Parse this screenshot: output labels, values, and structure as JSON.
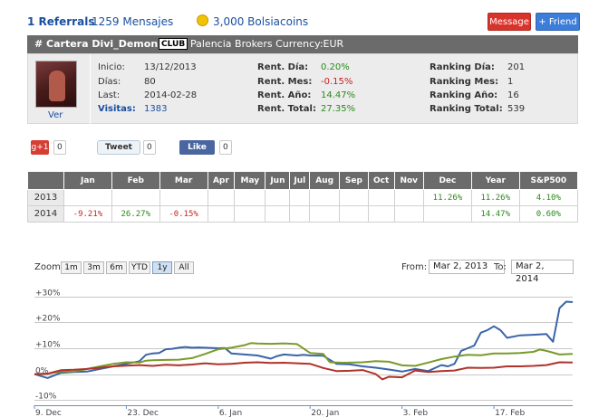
{
  "topbar": {
    "referrals": "1 Referrals",
    "mensajes": "1259 Mensajes",
    "bolsiacoins": "3,000 Bolsiacoins",
    "message_btn": "Message",
    "friend_btn": "+ Friend"
  },
  "header": {
    "title": "# Cartera Divi_Demon",
    "club_badge": "CLUB",
    "broker": "Palencia Brokers  Currency:EUR"
  },
  "profile": {
    "ver_link": "Ver",
    "stats_left": [
      {
        "label": "Inicio:",
        "value": "13/12/2013"
      },
      {
        "label": "Días:",
        "value": "80"
      },
      {
        "label": "Last:",
        "value": "2014-02-28"
      },
      {
        "label": "Visitas:",
        "value": "1383"
      }
    ],
    "stats_mid": [
      {
        "label": "Rent. Día:",
        "value": "0.20%"
      },
      {
        "label": "Rent. Mes:",
        "value": "-0.15%"
      },
      {
        "label": "Rent. Año:",
        "value": "14.47%"
      },
      {
        "label": "Rent. Total:",
        "value": "27.35%"
      }
    ],
    "stats_right": [
      {
        "label": "Ranking Día:",
        "value": "201"
      },
      {
        "label": "Ranking Mes:",
        "value": "1"
      },
      {
        "label": "Ranking Año:",
        "value": "16"
      },
      {
        "label": "Ranking Total:",
        "value": "539"
      }
    ]
  },
  "social": {
    "gplus_label": "g+1",
    "gplus_count": "0",
    "tweet_label": "Tweet",
    "tweet_count": "0",
    "like_label": "Like",
    "like_count": "0"
  },
  "table": {
    "headers": [
      "",
      "Jan",
      "Feb",
      "Mar",
      "Apr",
      "May",
      "Jun",
      "Jul",
      "Aug",
      "Sep",
      "Oct",
      "Nov",
      "Dec",
      "Year",
      "S&P500"
    ],
    "rows": [
      {
        "year": "2013",
        "cells": [
          "",
          "",
          "",
          "",
          "",
          "",
          "",
          "",
          "",
          "",
          "",
          "11.26%",
          "11.26%",
          "4.10%"
        ]
      },
      {
        "year": "2014",
        "cells": [
          "-9.21%",
          "26.27%",
          "-0.15%",
          "",
          "",
          "",
          "",
          "",
          "",
          "",
          "",
          "",
          "14.47%",
          "0.60%"
        ]
      }
    ]
  },
  "zoom": {
    "label": "Zoom",
    "buttons": [
      "1m",
      "3m",
      "6m",
      "YTD",
      "1y",
      "All"
    ],
    "selected": "1y",
    "from_label": "From:",
    "from_value": "Mar 2, 2013",
    "to_label": "To:",
    "to_value": "Mar 2, 2014"
  },
  "chart_data": {
    "type": "line",
    "y_ticks": [
      "+30%",
      "+20%",
      "+10%",
      "0%",
      "-10%"
    ],
    "y_tick_values": [
      30,
      20,
      10,
      0,
      -10
    ],
    "ylim": [
      -12,
      32
    ],
    "x_ticks": [
      "9. Dec",
      "23. Dec",
      "6. Jan",
      "20. Jan",
      "3. Feb",
      "17. Feb"
    ],
    "x_tick_days": [
      0,
      14,
      28,
      42,
      56,
      70
    ],
    "x_range_days": [
      0,
      82
    ],
    "series": [
      {
        "color": "#3a64a8",
        "points": [
          [
            0,
            0
          ],
          [
            2,
            -1.5
          ],
          [
            4,
            0.5
          ],
          [
            6,
            0.8
          ],
          [
            8,
            1
          ],
          [
            10,
            2
          ],
          [
            12,
            3
          ],
          [
            14,
            4
          ],
          [
            15,
            4.5
          ],
          [
            16,
            5
          ],
          [
            17,
            7.5
          ],
          [
            18,
            8
          ],
          [
            19,
            8.2
          ],
          [
            20,
            9.6
          ],
          [
            21,
            9.8
          ],
          [
            22,
            10.2
          ],
          [
            23,
            10.5
          ],
          [
            24,
            10.2
          ],
          [
            25,
            10.3
          ],
          [
            26,
            10.2
          ],
          [
            28,
            10
          ],
          [
            29,
            10.1
          ],
          [
            30,
            8
          ],
          [
            32,
            7.6
          ],
          [
            34,
            7.2
          ],
          [
            36,
            6
          ],
          [
            37,
            7
          ],
          [
            38,
            7.6
          ],
          [
            40,
            7.2
          ],
          [
            41,
            7.5
          ],
          [
            42,
            7.2
          ],
          [
            44,
            7.1
          ],
          [
            46,
            4
          ],
          [
            48,
            3.8
          ],
          [
            50,
            3
          ],
          [
            52,
            2.5
          ],
          [
            54,
            1.8
          ],
          [
            56,
            1
          ],
          [
            58,
            2
          ],
          [
            60,
            1.2
          ],
          [
            62,
            3.5
          ],
          [
            63,
            3
          ],
          [
            64,
            4
          ],
          [
            65,
            9
          ],
          [
            66,
            10
          ],
          [
            67,
            11
          ],
          [
            68,
            16
          ],
          [
            69,
            17
          ],
          [
            70,
            18.5
          ],
          [
            71,
            17
          ],
          [
            72,
            14
          ],
          [
            74,
            15
          ],
          [
            76,
            15.2
          ],
          [
            78,
            15.5
          ],
          [
            79,
            12.5
          ],
          [
            80,
            25.5
          ],
          [
            81,
            28
          ],
          [
            82,
            27.8
          ]
        ]
      },
      {
        "color": "#7a9a2a",
        "points": [
          [
            0,
            0
          ],
          [
            2,
            0.2
          ],
          [
            4,
            1
          ],
          [
            6,
            1
          ],
          [
            8,
            2
          ],
          [
            10,
            3
          ],
          [
            12,
            4
          ],
          [
            14,
            4.6
          ],
          [
            16,
            4.5
          ],
          [
            17,
            5.2
          ],
          [
            18,
            5.4
          ],
          [
            20,
            5.5
          ],
          [
            22,
            5.6
          ],
          [
            24,
            6.2
          ],
          [
            26,
            7.8
          ],
          [
            28,
            9.6
          ],
          [
            30,
            10.2
          ],
          [
            32,
            11.2
          ],
          [
            33,
            12
          ],
          [
            34,
            11.8
          ],
          [
            36,
            11.7
          ],
          [
            38,
            11.9
          ],
          [
            40,
            11.6
          ],
          [
            42,
            8.2
          ],
          [
            44,
            7.8
          ],
          [
            45,
            4.6
          ],
          [
            47,
            4.4
          ],
          [
            50,
            4.6
          ],
          [
            52,
            5
          ],
          [
            54,
            4.8
          ],
          [
            56,
            3.4
          ],
          [
            58,
            3.2
          ],
          [
            60,
            4.5
          ],
          [
            62,
            5.8
          ],
          [
            64,
            6.8
          ],
          [
            66,
            7.5
          ],
          [
            68,
            7.3
          ],
          [
            70,
            8
          ],
          [
            72,
            8
          ],
          [
            74,
            8.2
          ],
          [
            76,
            8.6
          ],
          [
            77,
            9.5
          ],
          [
            78,
            9
          ],
          [
            80,
            7.6
          ],
          [
            82,
            7.8
          ]
        ]
      },
      {
        "color": "#b0322a",
        "points": [
          [
            0,
            0
          ],
          [
            2,
            0.2
          ],
          [
            4,
            1.5
          ],
          [
            6,
            1.7
          ],
          [
            8,
            2
          ],
          [
            10,
            2.5
          ],
          [
            12,
            3
          ],
          [
            14,
            3.3
          ],
          [
            16,
            3.5
          ],
          [
            18,
            3.2
          ],
          [
            20,
            3.6
          ],
          [
            22,
            3.4
          ],
          [
            24,
            3.7
          ],
          [
            26,
            4.2
          ],
          [
            28,
            3.8
          ],
          [
            30,
            4
          ],
          [
            32,
            4.4
          ],
          [
            34,
            4.6
          ],
          [
            36,
            4.3
          ],
          [
            38,
            4.4
          ],
          [
            40,
            4.2
          ],
          [
            42,
            4
          ],
          [
            44,
            2.4
          ],
          [
            46,
            1.2
          ],
          [
            48,
            1.3
          ],
          [
            50,
            1.6
          ],
          [
            52,
            0
          ],
          [
            53,
            -2
          ],
          [
            54,
            -1
          ],
          [
            56,
            -1.2
          ],
          [
            58,
            1.4
          ],
          [
            60,
            0.8
          ],
          [
            62,
            1.2
          ],
          [
            64,
            1.4
          ],
          [
            66,
            2.5
          ],
          [
            68,
            2.4
          ],
          [
            70,
            2.5
          ],
          [
            72,
            3
          ],
          [
            74,
            3
          ],
          [
            76,
            3.2
          ],
          [
            78,
            3.5
          ],
          [
            80,
            4.6
          ],
          [
            82,
            4.5
          ]
        ]
      }
    ]
  }
}
